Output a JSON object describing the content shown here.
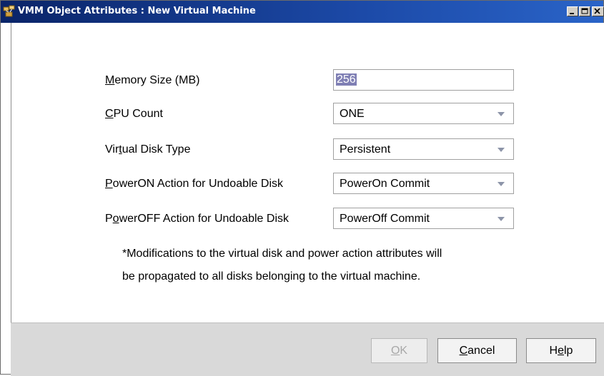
{
  "window": {
    "title": "VMM Object Attributes : New Virtual Machine",
    "icon": "vmm-app-icon",
    "controls": [
      "minimize",
      "maximize",
      "close"
    ]
  },
  "form": {
    "memory": {
      "label_pre": "",
      "label_mnemonic": "M",
      "label_post": "emory Size (MB)",
      "value": "256"
    },
    "cpu": {
      "label_pre": "",
      "label_mnemonic": "C",
      "label_post": "PU Count",
      "value": "ONE"
    },
    "disk_type": {
      "label_pre": "Vir",
      "label_mnemonic": "t",
      "label_post": "ual Disk Type",
      "value": "Persistent"
    },
    "poweron": {
      "label_pre": "",
      "label_mnemonic": "P",
      "label_post": "owerON Action for Undoable Disk",
      "value": "PowerOn Commit"
    },
    "poweroff": {
      "label_pre": "P",
      "label_mnemonic": "o",
      "label_post": "werOFF Action for Undoable Disk",
      "value": "PowerOff Commit"
    }
  },
  "note": {
    "line1": "*Modifications to the virtual disk and power action attributes will",
    "line2": "be propagated to all disks belonging to the virtual machine."
  },
  "buttons": {
    "ok": {
      "pre": "",
      "mnemonic": "O",
      "post": "K",
      "enabled": false
    },
    "cancel": {
      "pre": "",
      "mnemonic": "C",
      "post": "ancel",
      "enabled": true
    },
    "help": {
      "pre": "H",
      "mnemonic": "e",
      "post": "lp",
      "enabled": true
    }
  },
  "colors": {
    "titlebar_start": "#0a2468",
    "titlebar_end": "#2a64c8",
    "selection": "#7f7fb4",
    "footer_bg": "#d9d9d9"
  }
}
